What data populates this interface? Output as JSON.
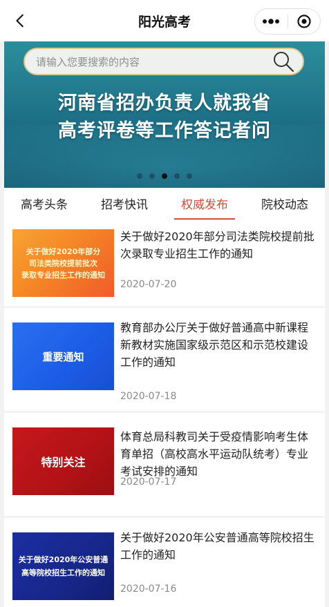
{
  "header": {
    "title": "阳光高考",
    "more_glyph": "•••",
    "back_icon": "chevron-left-icon",
    "close_icon": "target-icon"
  },
  "banner": {
    "search_placeholder": "请输入您要搜索的内容",
    "headline_line1": "河南省招办负责人就我省",
    "headline_line2": "高考评卷等工作答记者问",
    "slides": 5,
    "active_slide": 3
  },
  "tabs": [
    {
      "label": "高考头条"
    },
    {
      "label": "招考快讯"
    },
    {
      "label": "权威发布"
    },
    {
      "label": "院校动态"
    }
  ],
  "active_tab": 2,
  "articles": [
    {
      "thumb_lines": [
        "关于做好2020年部分",
        "司法类院校提前批次",
        "录取专业招生工作的通知"
      ],
      "title": "关于做好2020年部分司法类院校提前批次录取专业招生工作的通知",
      "date": "2020-07-20"
    },
    {
      "thumb_lines": [
        "重要通知"
      ],
      "title": "教育部办公厅关于做好普通高中新课程新教材实施国家级示范区和示范校建设工作的通知",
      "date": "2020-07-18"
    },
    {
      "thumb_lines": [
        "特别关注"
      ],
      "title": "体育总局科教司关于受疫情影响考生体育单招（高校高水平运动队统考）专业考试安排的通知",
      "date": "2020-07-17"
    },
    {
      "thumb_lines": [
        "关于做好2020年公安普通",
        "高等院校招生工作的通知"
      ],
      "title": "关于做好2020年公安普通高等院校招生工作的通知",
      "date": "2020-07-16"
    }
  ],
  "colors": {
    "accent": "#d94a3a",
    "banner": "#1d6f85"
  }
}
